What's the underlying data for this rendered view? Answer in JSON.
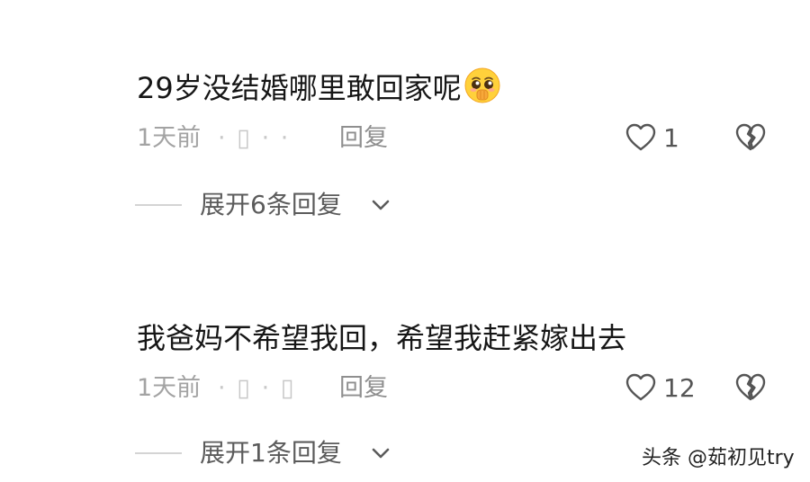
{
  "comments": [
    {
      "text": "29岁没结婚哪里敢回家呢",
      "emoji": "pleading-face-emoji",
      "time": "1天前",
      "location_blurred": "· ▯ · ·",
      "reply_label": "回复",
      "like_count": "1",
      "expand_label": "展开6条回复"
    },
    {
      "text": "我爸妈不希望我回，希望我赶紧嫁出去",
      "time": "1天前",
      "location_blurred": "· ▯ · ▯",
      "reply_label": "回复",
      "like_count": "12",
      "expand_label": "展开1条回复"
    }
  ],
  "watermark": "头条 @茹初见try",
  "colors": {
    "text": "#161616",
    "meta": "#a3a3a3",
    "reply": "#8f8f8f",
    "expand": "#5b5b5b",
    "icon": "#555555"
  },
  "icons": [
    "heart-outline-icon",
    "broken-heart-icon",
    "chevron-down-icon",
    "pleading-face-emoji"
  ]
}
